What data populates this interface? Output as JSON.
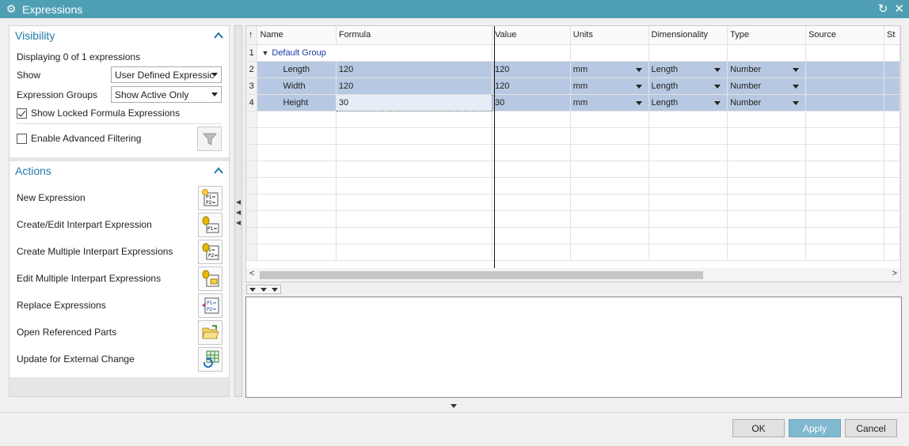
{
  "window": {
    "title": "Expressions"
  },
  "visibility": {
    "header": "Visibility",
    "displaying": "Displaying 0 of 1 expressions",
    "show_label": "Show",
    "show_value": "User Defined Expressic",
    "groups_label": "Expression Groups",
    "groups_value": "Show Active Only",
    "locked_label": "Show Locked Formula Expressions",
    "locked_checked": true,
    "advanced_label": "Enable Advanced Filtering",
    "advanced_checked": false
  },
  "actions": {
    "header": "Actions",
    "items": [
      {
        "label": "New Expression",
        "icon": "new-expression-icon"
      },
      {
        "label": "Create/Edit Interpart Expression",
        "icon": "interpart-expression-icon"
      },
      {
        "label": "Create Multiple Interpart Expressions",
        "icon": "multiple-interpart-icon"
      },
      {
        "label": "Edit Multiple Interpart Expressions",
        "icon": "edit-multiple-interpart-icon"
      },
      {
        "label": "Replace Expressions",
        "icon": "replace-expressions-icon"
      },
      {
        "label": "Open Referenced Parts",
        "icon": "folder-open-icon"
      },
      {
        "label": "Update for External Change",
        "icon": "update-table-icon"
      }
    ]
  },
  "grid": {
    "columns": [
      "↑",
      "Name",
      "Formula",
      "Value",
      "Units",
      "Dimensionality",
      "Type",
      "Source",
      "St"
    ],
    "group": {
      "num": "1",
      "label": "Default Group"
    },
    "rows": [
      {
        "num": "2",
        "name": "Length",
        "formula": "120",
        "value": "120",
        "units": "mm",
        "dim": "Length",
        "type": "Number"
      },
      {
        "num": "3",
        "name": "Width",
        "formula": "120",
        "value": "120",
        "units": "mm",
        "dim": "Length",
        "type": "Number"
      },
      {
        "num": "4",
        "name": "Height",
        "formula": "30",
        "value": "30",
        "units": "mm",
        "dim": "Length",
        "type": "Number"
      }
    ]
  },
  "buttons": {
    "ok": "OK",
    "apply": "Apply",
    "cancel": "Cancel"
  }
}
